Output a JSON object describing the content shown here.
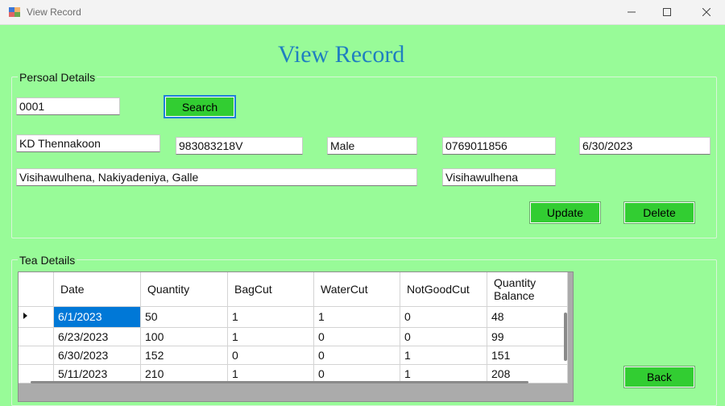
{
  "window": {
    "title": "View Record"
  },
  "heading": "View Record",
  "personal": {
    "group_label": "Persoal Details",
    "id_value": "0001",
    "search_label": "Search",
    "name": "KD Thennakoon",
    "nic": "983083218V",
    "gender": "Male",
    "phone": "0769011856",
    "date": "6/30/2023",
    "address": "Visihawulhena, Nakiyadeniya, Galle",
    "area": "Visihawulhena",
    "update_label": "Update",
    "delete_label": "Delete"
  },
  "tea": {
    "group_label": "Tea Details",
    "columns": [
      "Date",
      "Quantity",
      "BagCut",
      "WaterCut",
      "NotGoodCut",
      "Quantity Balance"
    ],
    "rows": [
      [
        "6/1/2023",
        "50",
        "1",
        "1",
        "0",
        "48"
      ],
      [
        "6/23/2023",
        "100",
        "1",
        "0",
        "0",
        "99"
      ],
      [
        "6/30/2023",
        "152",
        "0",
        "0",
        "1",
        "151"
      ],
      [
        "5/11/2023",
        "210",
        "1",
        "0",
        "1",
        "208"
      ]
    ],
    "back_label": "Back"
  }
}
